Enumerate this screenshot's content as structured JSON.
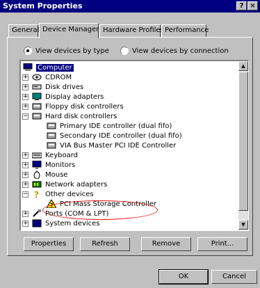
{
  "window": {
    "title": "System Properties",
    "help_button": "?",
    "close_button": "×"
  },
  "tabs": [
    {
      "label": "General",
      "active": false
    },
    {
      "label": "Device Manager",
      "active": true
    },
    {
      "label": "Hardware Profiles",
      "active": false
    },
    {
      "label": "Performance",
      "active": false
    }
  ],
  "view_options": {
    "by_type": {
      "label": "View devices by type",
      "selected": true
    },
    "by_connection": {
      "label": "View devices by connection",
      "selected": false
    }
  },
  "device_tree": [
    {
      "label": "Computer",
      "level": 0,
      "expander": "",
      "icon": "computer-icon",
      "selected": true
    },
    {
      "label": "CDROM",
      "level": 1,
      "expander": "+",
      "icon": "cdrom-icon"
    },
    {
      "label": "Disk drives",
      "level": 1,
      "expander": "+",
      "icon": "disk-drive-icon"
    },
    {
      "label": "Display adapters",
      "level": 1,
      "expander": "+",
      "icon": "display-adapter-icon"
    },
    {
      "label": "Floppy disk controllers",
      "level": 1,
      "expander": "+",
      "icon": "floppy-controller-icon"
    },
    {
      "label": "Hard disk controllers",
      "level": 1,
      "expander": "−",
      "icon": "hard-disk-controller-icon"
    },
    {
      "label": "Primary IDE controller (dual fifo)",
      "level": 2,
      "expander": "",
      "icon": "controller-icon"
    },
    {
      "label": "Secondary IDE controller (dual fifo)",
      "level": 2,
      "expander": "",
      "icon": "controller-icon"
    },
    {
      "label": "VIA Bus Master PCI IDE Controller",
      "level": 2,
      "expander": "",
      "icon": "controller-icon"
    },
    {
      "label": "Keyboard",
      "level": 1,
      "expander": "+",
      "icon": "keyboard-icon"
    },
    {
      "label": "Monitors",
      "level": 1,
      "expander": "+",
      "icon": "monitor-icon"
    },
    {
      "label": "Mouse",
      "level": 1,
      "expander": "+",
      "icon": "mouse-icon"
    },
    {
      "label": "Network adapters",
      "level": 1,
      "expander": "+",
      "icon": "network-adapter-icon"
    },
    {
      "label": "Other devices",
      "level": 1,
      "expander": "−",
      "icon": "question-mark-icon"
    },
    {
      "label": "PCI Mass Storage Controller",
      "level": 2,
      "expander": "",
      "icon": "warning-icon"
    },
    {
      "label": "Ports (COM & LPT)",
      "level": 1,
      "expander": "+",
      "icon": "port-icon"
    },
    {
      "label": "System devices",
      "level": 1,
      "expander": "+",
      "icon": "system-device-icon"
    }
  ],
  "buttons": {
    "properties": "Properties",
    "refresh": "Refresh",
    "remove": "Remove",
    "print": "Print...",
    "ok": "OK",
    "cancel": "Cancel"
  },
  "colors": {
    "title_bar": "#000080",
    "selection": "#000080",
    "annotation": "#e01818",
    "window_bg": "#c0c0c0"
  }
}
